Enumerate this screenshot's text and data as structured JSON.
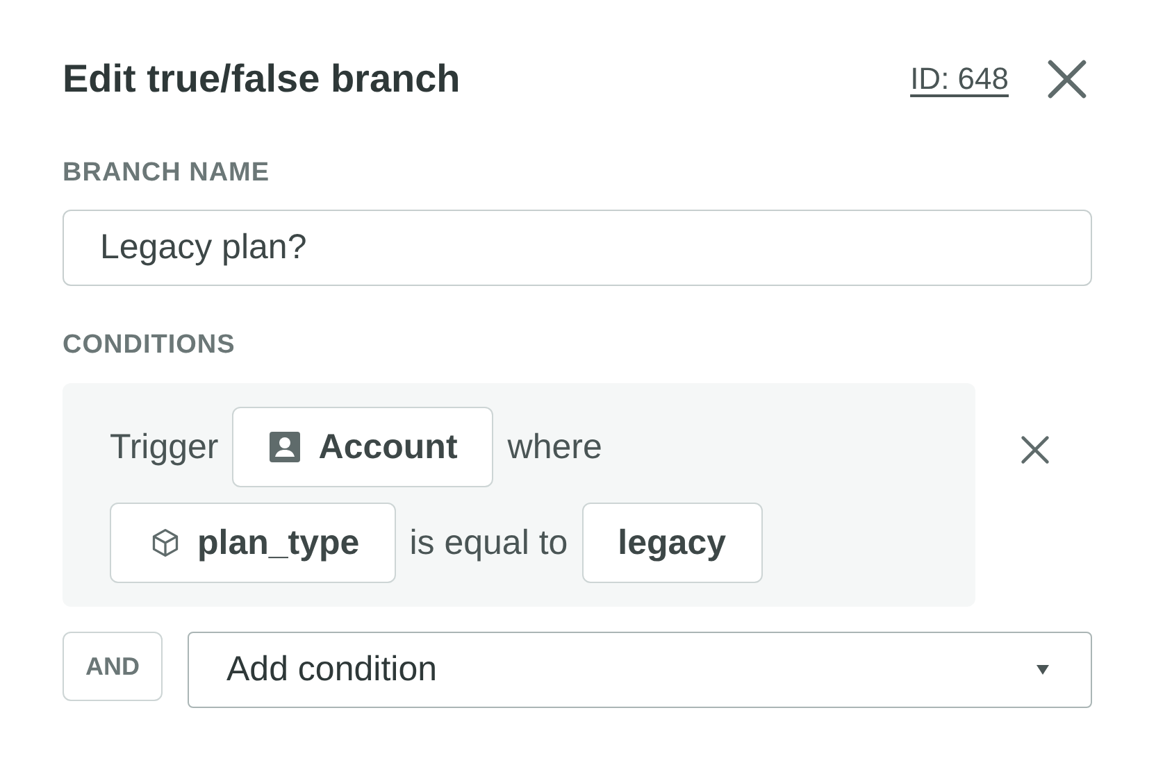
{
  "header": {
    "title": "Edit true/false branch",
    "id_link": "ID: 648"
  },
  "branch_name": {
    "label": "BRANCH NAME",
    "value": "Legacy plan?"
  },
  "conditions": {
    "label": "CONDITIONS",
    "groups": [
      {
        "tokens": [
          {
            "kind": "text",
            "text": "Trigger"
          },
          {
            "kind": "entity",
            "text": "Account"
          },
          {
            "kind": "text",
            "text": "where"
          },
          {
            "kind": "property",
            "text": "plan_type"
          },
          {
            "kind": "text",
            "text": "is equal to"
          },
          {
            "kind": "value",
            "text": "legacy"
          }
        ]
      }
    ],
    "operator": "AND",
    "add_placeholder": "Add condition"
  }
}
